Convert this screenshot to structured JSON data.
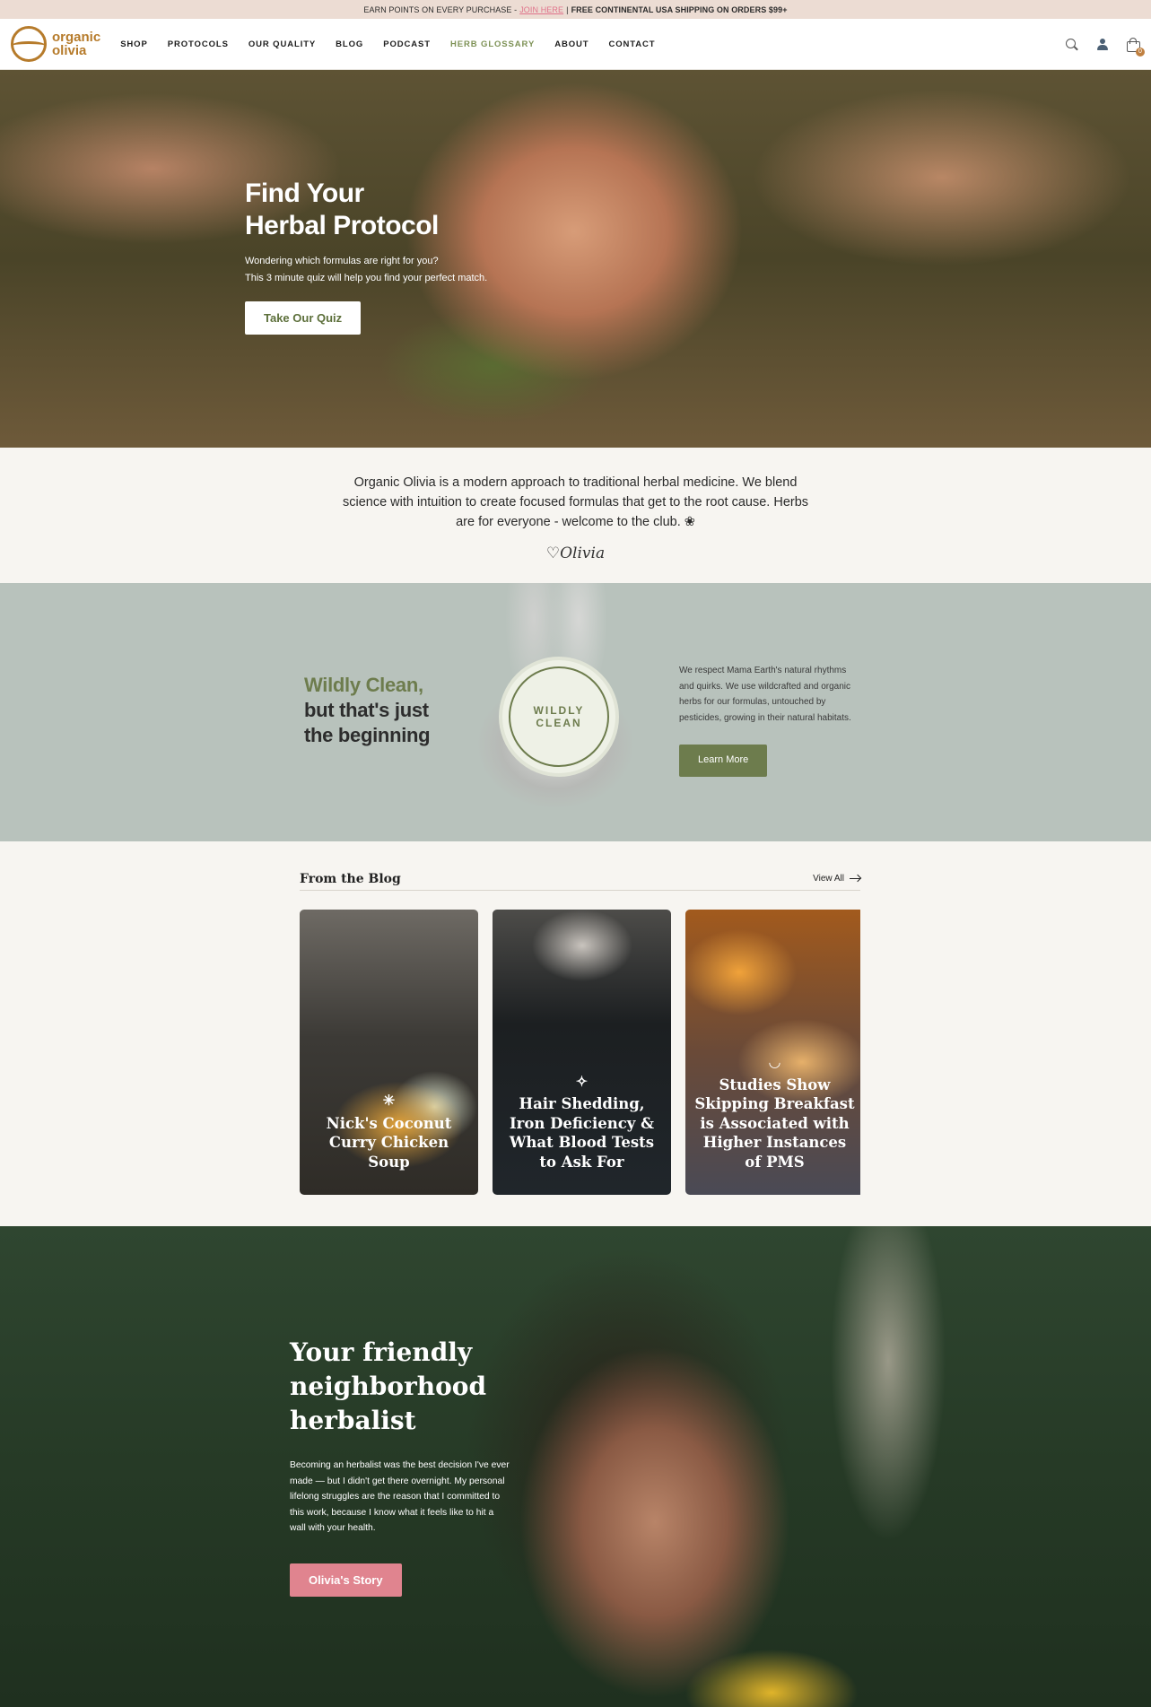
{
  "announcement": {
    "prefix": "EARN POINTS ON EVERY PURCHASE -",
    "link": "JOIN HERE",
    "divider": "|",
    "shipping": "FREE CONTINENTAL USA SHIPPING ON ORDERS $99+"
  },
  "header": {
    "logo_line1": "organic",
    "logo_line2": "olivia",
    "nav": [
      "SHOP",
      "PROTOCOLS",
      "OUR QUALITY",
      "BLOG",
      "PODCAST",
      "HERB GLOSSARY",
      "ABOUT",
      "CONTACT"
    ],
    "cart_count": "0",
    "accent_color": "#7e9256",
    "logo_color": "#b67b2b"
  },
  "hero": {
    "title_line1": "Find Your",
    "title_line2": "Herbal Protocol",
    "text_line1": "Wondering which formulas are right for you?",
    "text_line2": "This 3 minute quiz will help you find your perfect match.",
    "button": "Take Our Quiz"
  },
  "intro": {
    "text": "Organic Olivia is a modern approach to traditional herbal medicine. We blend science with intuition to create focused formulas that get to the root cause. Herbs are for everyone - welcome to the club. ❀",
    "signature": "♡Olivia"
  },
  "clean": {
    "heading_green": "Wildly Clean,",
    "heading_line2": "but that's just",
    "heading_line3": "the beginning",
    "badge_text": "WILDLY CLEAN",
    "body": "We respect Mama Earth's natural rhythms and quirks. We use wildcrafted and organic herbs for our formulas, untouched by pesticides, growing in their natural habitats.",
    "button": "Learn More"
  },
  "blog": {
    "title": "From the Blog",
    "view_all": "View All",
    "posts": [
      {
        "title": "Nick's Coconut Curry Chicken Soup",
        "spark": "✳"
      },
      {
        "title": "Hair Shedding, Iron Deficiency & What Blood Tests to Ask For",
        "spark": "✧"
      },
      {
        "title": "Studies Show Skipping Breakfast is Associated with Higher Instances of PMS",
        "spark": "◡"
      }
    ]
  },
  "story": {
    "title_line1": "Your friendly",
    "title_line2": "neighborhood",
    "title_line3": "herbalist",
    "body": "Becoming an herbalist was the best decision I've ever made — but I didn't get there overnight. My personal lifelong struggles are the reason that I committed to this work, because I know what it feels like to hit a wall with your health.",
    "button": "Olivia's Story"
  }
}
